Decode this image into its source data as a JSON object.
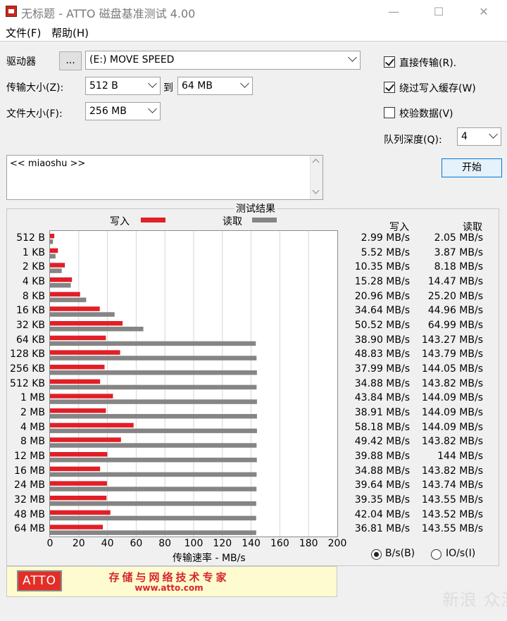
{
  "window": {
    "title": "无标题 - ATTO 磁盘基准测试 4.00",
    "minimize": "—",
    "maximize": "☐",
    "close": "✕"
  },
  "menu": {
    "file": "文件(F)",
    "help": "帮助(H)"
  },
  "drive": {
    "label": "驱动器",
    "browse": "...",
    "value": "(E:) MOVE SPEED"
  },
  "transfer": {
    "label": "传输大小(Z):",
    "from": "512 B",
    "to_label": "到",
    "to": "64 MB"
  },
  "filesize": {
    "label": "文件大小(F):",
    "value": "256 MB"
  },
  "options": {
    "direct_io": "直接传输(R).",
    "direct_io_checked": true,
    "bypass_cache": "绕过写入缓存(W)",
    "bypass_cache_checked": true,
    "verify": "校验数据(V)",
    "verify_checked": false,
    "queue_label": "队列深度(Q):",
    "queue_value": "4",
    "start": "开始"
  },
  "description": "<< miaoshu >>",
  "results": {
    "title": "测试结果",
    "legend_write": "写入",
    "legend_read": "读取",
    "col_write": "写入",
    "col_read": "读取",
    "xlabel": "传输速率 - MB/s",
    "unit_bytes": "B/s(B)",
    "unit_io": "IO/s(I)",
    "unit_selected": "bytes"
  },
  "colors": {
    "write": "#e11f26",
    "read": "#858585"
  },
  "chart_data": {
    "type": "bar",
    "orientation": "horizontal",
    "xlim": [
      0,
      200
    ],
    "xticks": [
      0,
      20,
      40,
      60,
      80,
      100,
      120,
      140,
      160,
      180,
      200
    ],
    "categories": [
      "512 B",
      "1 KB",
      "2 KB",
      "4 KB",
      "8 KB",
      "16 KB",
      "32 KB",
      "64 KB",
      "128 KB",
      "256 KB",
      "512 KB",
      "1 MB",
      "2 MB",
      "4 MB",
      "8 MB",
      "12 MB",
      "16 MB",
      "24 MB",
      "32 MB",
      "48 MB",
      "64 MB"
    ],
    "series": [
      {
        "name": "写入",
        "values": [
          2.99,
          5.52,
          10.35,
          15.28,
          20.96,
          34.64,
          50.52,
          38.9,
          48.83,
          37.99,
          34.88,
          43.84,
          38.91,
          58.18,
          49.42,
          39.88,
          34.88,
          39.64,
          39.35,
          42.04,
          36.81
        ]
      },
      {
        "name": "读取",
        "values": [
          2.05,
          3.87,
          8.18,
          14.47,
          25.2,
          44.96,
          64.99,
          143.27,
          143.79,
          144.05,
          143.82,
          144.09,
          144.09,
          144.09,
          143.82,
          144.0,
          143.82,
          143.74,
          143.55,
          143.52,
          143.55
        ]
      }
    ],
    "write_text": [
      "2.99 MB/s",
      "5.52 MB/s",
      "10.35 MB/s",
      "15.28 MB/s",
      "20.96 MB/s",
      "34.64 MB/s",
      "50.52 MB/s",
      "38.90 MB/s",
      "48.83 MB/s",
      "37.99 MB/s",
      "34.88 MB/s",
      "43.84 MB/s",
      "38.91 MB/s",
      "58.18 MB/s",
      "49.42 MB/s",
      "39.88 MB/s",
      "34.88 MB/s",
      "39.64 MB/s",
      "39.35 MB/s",
      "42.04 MB/s",
      "36.81 MB/s"
    ],
    "read_text": [
      "2.05 MB/s",
      "3.87 MB/s",
      "8.18 MB/s",
      "14.47 MB/s",
      "25.20 MB/s",
      "44.96 MB/s",
      "64.99 MB/s",
      "143.27 MB/s",
      "143.79 MB/s",
      "144.05 MB/s",
      "143.82 MB/s",
      "144.09 MB/s",
      "144.09 MB/s",
      "144.09 MB/s",
      "143.82 MB/s",
      "144 MB/s",
      "143.82 MB/s",
      "143.74 MB/s",
      "143.55 MB/s",
      "143.52 MB/s",
      "143.55 MB/s"
    ]
  },
  "banner": {
    "logo": "ATTO",
    "slogan": "存储与网络技术专家",
    "site": "www.atto.com"
  },
  "watermark": "新浪 众测"
}
